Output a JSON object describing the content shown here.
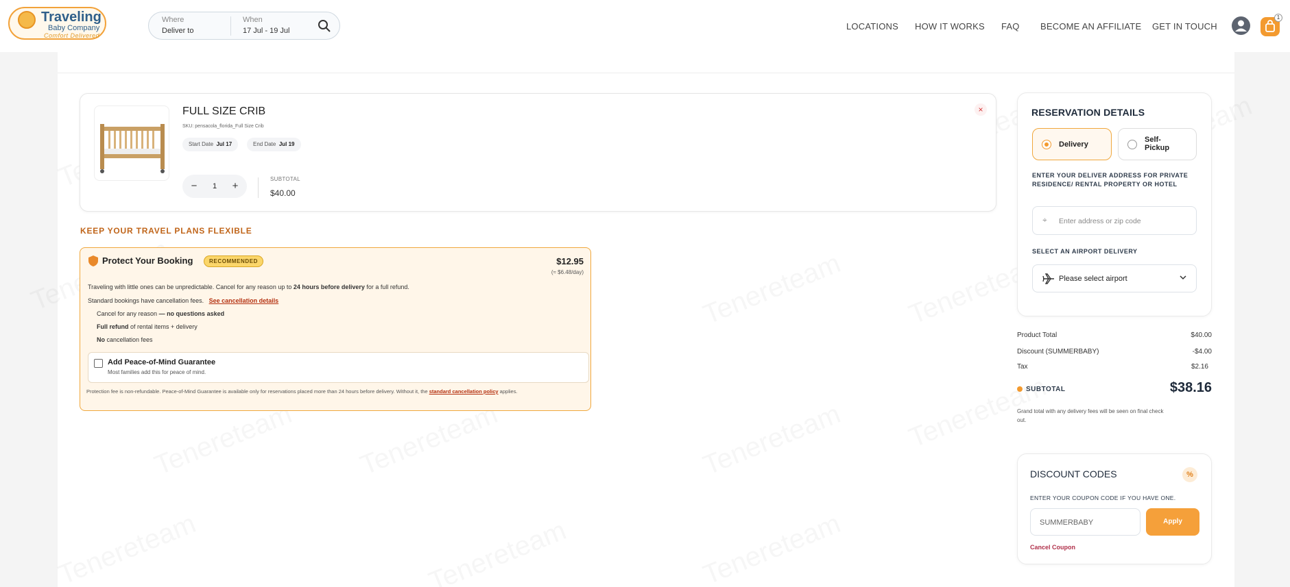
{
  "brand": {
    "name": "Traveling",
    "sub": "Baby Company",
    "tagline": "Comfort Delivered"
  },
  "search": {
    "where_label": "Where",
    "where_value": "Deliver to",
    "when_label": "When",
    "when_value": "17 Jul - 19 Jul"
  },
  "nav": [
    "LOCATIONS",
    "HOW IT WORKS",
    "FAQ",
    "BECOME AN AFFILIATE",
    "GET IN TOUCH"
  ],
  "cart": {
    "count": "1"
  },
  "item": {
    "title": "FULL SIZE CRIB",
    "sku": "SKU: pensacola_florida_Full Size Crib",
    "start_label": "Start Date",
    "start_value": "Jul 17",
    "end_label": "End Date",
    "end_value": "Jul 19",
    "quantity": "1",
    "subtotal_label": "SUBTOTAL",
    "subtotal_value": "$40.00",
    "close_symbol": "×"
  },
  "flex": {
    "heading": "KEEP YOUR TRAVEL PLANS FLEXIBLE",
    "title": "Protect Your Booking",
    "badge": "RECOMMENDED",
    "price": "$12.95",
    "per_day": "(≈ $6.48/day)",
    "line1_a": "Traveling with little ones can be unpredictable. Cancel for any reason up to ",
    "line1_b": "24 hours before delivery",
    "line1_c": " for a full refund.",
    "line2": "Standard bookings have cancellation fees.",
    "line2_link": "See cancellation details",
    "b1_a": "Cancel for any reason",
    "b1_b": " — no questions asked",
    "b2_a": "Full refund",
    "b2_b": " of rental items + delivery",
    "b3_a": "No",
    "b3_b": " cancellation fees",
    "peace_title": "Add Peace-of-Mind Guarantee",
    "peace_sub": "Most families add this for peace of mind.",
    "foot_a": "Protection fee is non-refundable. Peace-of-Mind Guarantee is available only for reservations placed more than 24 hours before delivery. Without it, the ",
    "foot_link": "standard cancellation policy",
    "foot_b": " applies."
  },
  "reservation": {
    "title": "RESERVATION DETAILS",
    "delivery": "Delivery",
    "self_pickup_1": "Self-",
    "self_pickup_2": "Pickup",
    "address_label": "ENTER YOUR DELIVER ADDRESS FOR PRIVATE RESIDENCE/ RENTAL PROPERTY OR HOTEL",
    "address_placeholder": "Enter address or zip code",
    "airport_label": "SELECT AN AIRPORT DELIVERY",
    "airport_value": "Please select airport"
  },
  "totals": {
    "product_total_label": "Product Total",
    "product_total": "$40.00",
    "discount_label": "Discount (SUMMERBABY)",
    "discount": "-$4.00",
    "tax_label": "Tax",
    "tax": "$2.16",
    "subtotal_label": "SUBTOTAL",
    "subtotal": "$38.16",
    "note": "Grand total with any delivery fees will be seen on final check out."
  },
  "discount": {
    "title": "DISCOUNT CODES",
    "symbol": "%",
    "label": "ENTER YOUR COUPON CODE IF YOU HAVE ONE.",
    "value": "SUMMERBABY",
    "apply": "Apply",
    "cancel": "Cancel Coupon"
  },
  "watermark": "Tenereteam",
  "colors": {
    "accent": "#f39a2f",
    "link": "#b4300f",
    "heading": "#c0651a"
  }
}
